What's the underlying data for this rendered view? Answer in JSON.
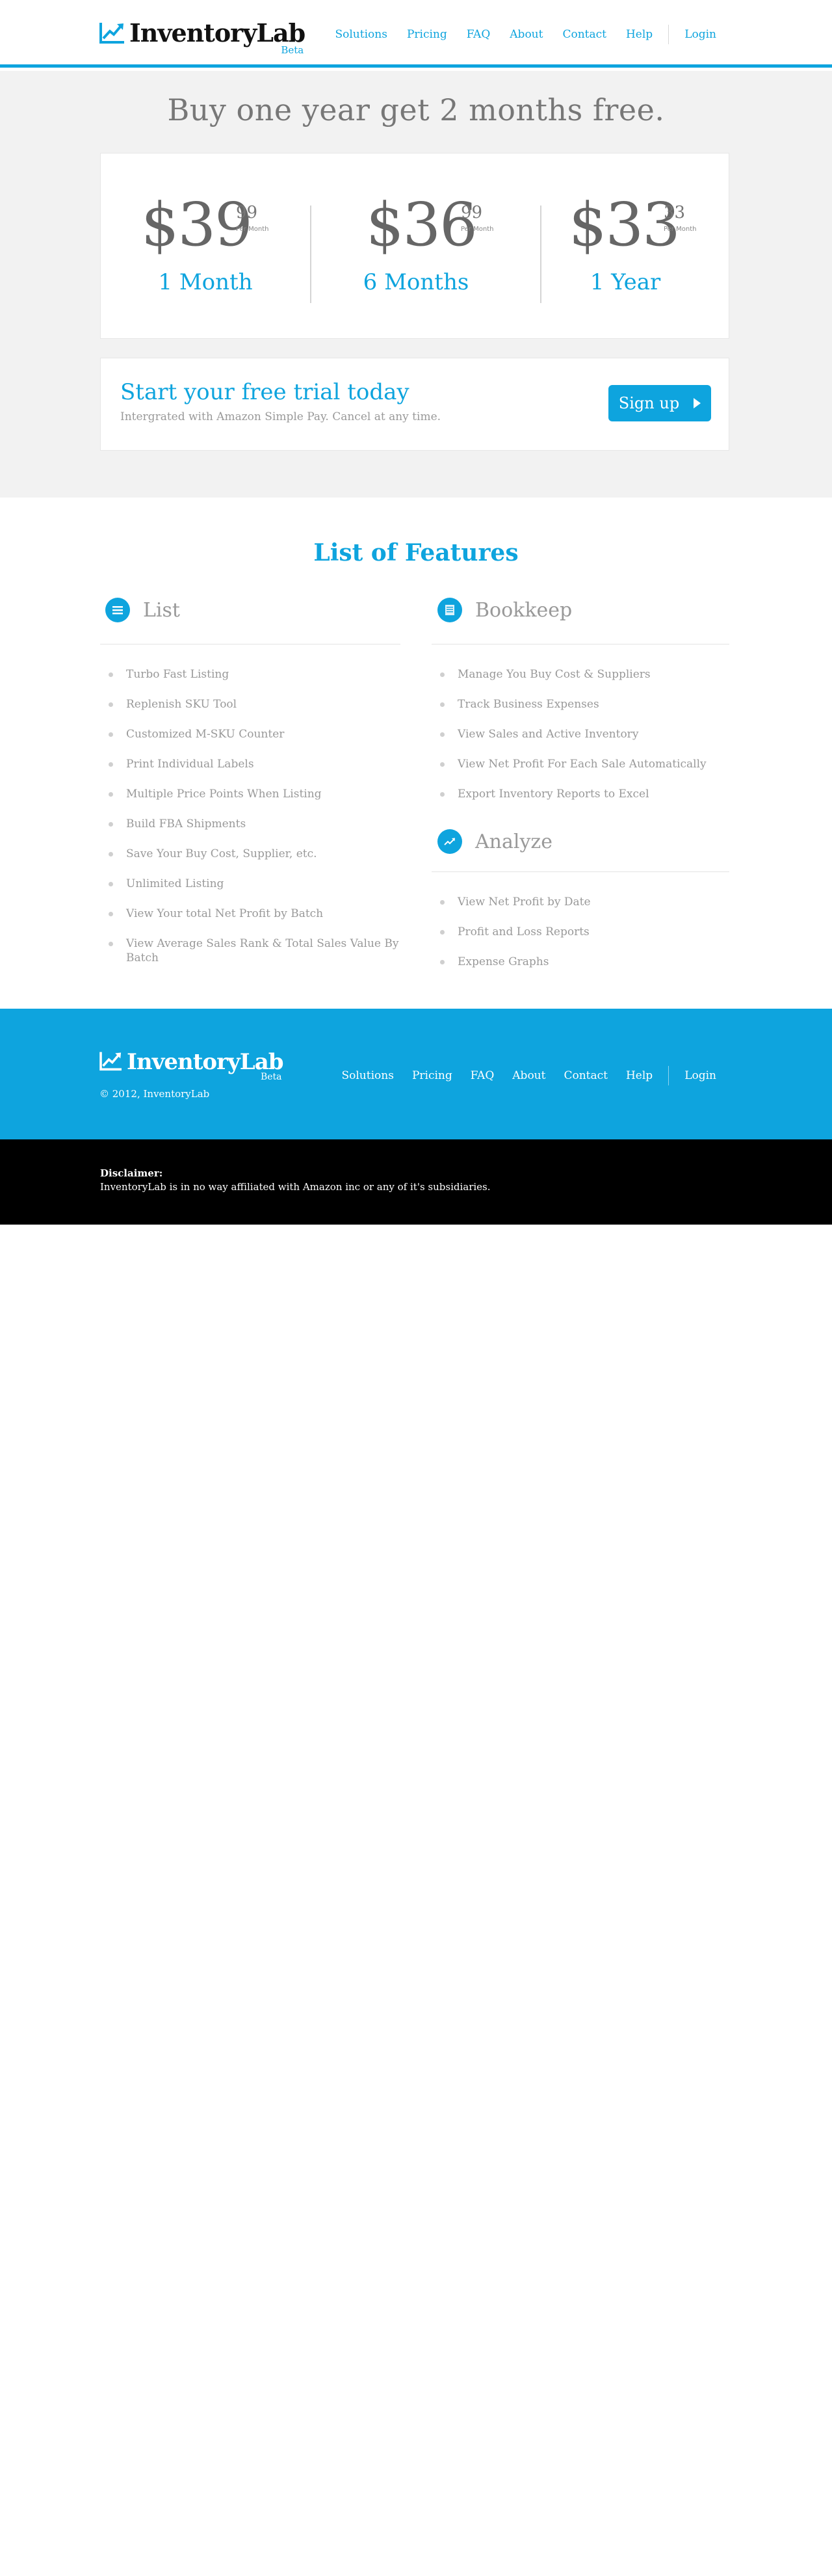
{
  "header": {
    "logo_text": "InventoryLab",
    "logo_badge": "Beta",
    "nav": [
      "Solutions",
      "Pricing",
      "FAQ",
      "About",
      "Contact",
      "Help"
    ],
    "login": "Login",
    "accent_color": "#0ea4de"
  },
  "pricing": {
    "headline": "Buy one year get 2 months free.",
    "plans": [
      {
        "dollars": "$39",
        "cents": "99",
        "per": "Per Month",
        "period": "1 Month"
      },
      {
        "dollars": "$36",
        "cents": "99",
        "per": "Per Month",
        "period": "6 Months"
      },
      {
        "dollars": "$33",
        "cents": "33",
        "per": "Per Month",
        "period": "1 Year"
      }
    ]
  },
  "trial": {
    "title": "Start your free trial today",
    "subtitle": "Intergrated with Amazon Simple Pay. Cancel at any time.",
    "button": "Sign up"
  },
  "features": {
    "title": "List of Features",
    "list": {
      "heading": "List",
      "icon": "list-icon",
      "items": [
        "Turbo Fast Listing",
        "Replenish SKU Tool",
        "Customized M-SKU Counter",
        "Print Individual Labels",
        "Multiple Price Points When Listing",
        "Build FBA Shipments",
        "Save Your Buy Cost, Supplier, etc.",
        "Unlimited Listing",
        "View Your total Net Profit by Batch",
        "View Average Sales Rank & Total Sales Value By Batch"
      ]
    },
    "bookkeep": {
      "heading": "Bookkeep",
      "icon": "ledger-icon",
      "items": [
        "Manage You Buy Cost & Suppliers",
        "Track Business Expenses",
        "View Sales and Active Inventory",
        "View Net Profit For Each Sale Automatically",
        "Export Inventory Reports to Excel"
      ]
    },
    "analyze": {
      "heading": "Analyze",
      "icon": "trend-icon",
      "items": [
        "View Net Profit by Date",
        "Profit and Loss Reports",
        "Expense Graphs"
      ]
    }
  },
  "footer": {
    "logo_text": "InventoryLab",
    "logo_badge": "Beta",
    "copyright": "© 2012, InventoryLab",
    "nav": [
      "Solutions",
      "Pricing",
      "FAQ",
      "About",
      "Contact",
      "Help"
    ],
    "login": "Login"
  },
  "disclaimer": {
    "title": "Disclaimer:",
    "text": "InventoryLab is in no way affiliated with Amazon inc or any of it's subsidiaries."
  }
}
